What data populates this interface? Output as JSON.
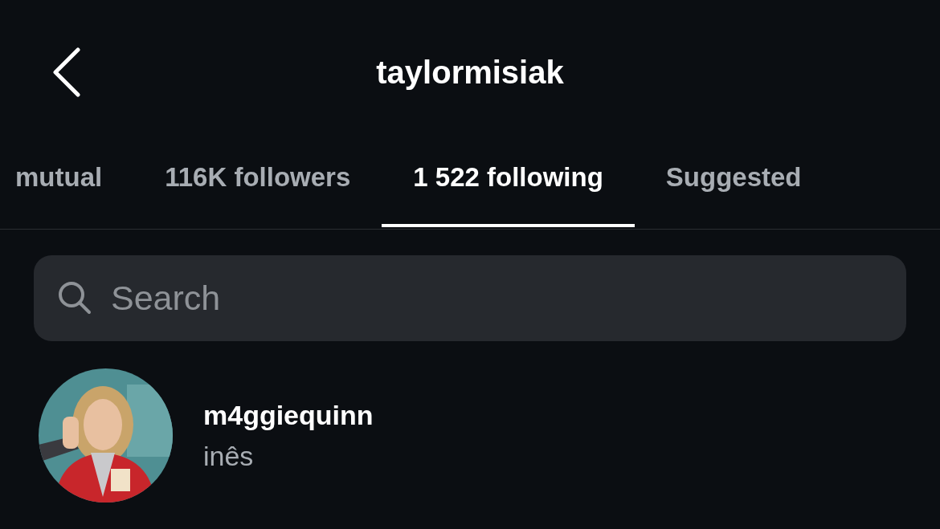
{
  "header": {
    "title": "taylormisiak"
  },
  "tabs": [
    {
      "label": "mutual",
      "selected": false
    },
    {
      "label": "116K followers",
      "selected": false
    },
    {
      "label": "1 522 following",
      "selected": true
    },
    {
      "label": "Suggested",
      "selected": false
    }
  ],
  "search": {
    "placeholder": "Search"
  },
  "accounts": [
    {
      "username": "m4ggiequinn",
      "name": "inês"
    }
  ]
}
